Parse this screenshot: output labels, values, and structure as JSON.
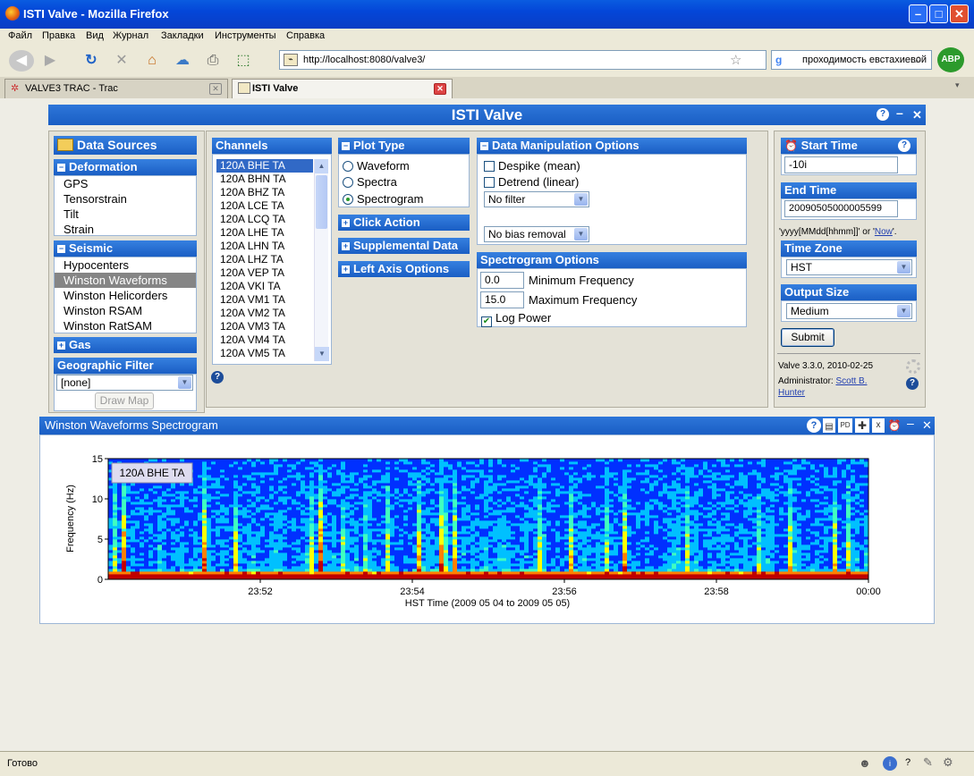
{
  "window": {
    "title": "ISTI Valve - Mozilla Firefox"
  },
  "menu": [
    "Файл",
    "Правка",
    "Вид",
    "Журнал",
    "Закладки",
    "Инструменты",
    "Справка"
  ],
  "nav": {
    "url": "http://localhost:8080/valve3/",
    "search": "проходимость евстахиевой т"
  },
  "tabs": [
    {
      "label": "VALVE3 TRAC - Trac"
    },
    {
      "label": "ISTI Valve"
    }
  ],
  "app": {
    "title": "ISTI Valve"
  },
  "sources": {
    "title": "Data Sources",
    "deformation": {
      "title": "Deformation",
      "items": [
        "GPS",
        "Tensorstrain",
        "Tilt",
        "Strain"
      ]
    },
    "seismic": {
      "title": "Seismic",
      "items": [
        "Hypocenters",
        "Winston Waveforms",
        "Winston Helicorders",
        "Winston RSAM",
        "Winston RatSAM"
      ],
      "selected": "Winston Waveforms"
    },
    "gas": {
      "title": "Gas"
    },
    "geo": {
      "title": "Geographic Filter",
      "value": "[none]",
      "draw_map": "Draw Map"
    }
  },
  "channels": {
    "title": "Channels",
    "items": [
      "120A BHE TA",
      "120A BHN TA",
      "120A BHZ TA",
      "120A LCE TA",
      "120A LCQ TA",
      "120A LHE TA",
      "120A LHN TA",
      "120A LHZ TA",
      "120A VEP TA",
      "120A VKI TA",
      "120A VM1 TA",
      "120A VM2 TA",
      "120A VM3 TA",
      "120A VM4 TA",
      "120A VM5 TA"
    ]
  },
  "plot_type": {
    "title": "Plot Type",
    "options": [
      "Waveform",
      "Spectra",
      "Spectrogram"
    ],
    "selected": "Spectrogram"
  },
  "sections": {
    "click_action": "Click Action",
    "supplemental": "Supplemental Data",
    "left_axis": "Left Axis Options"
  },
  "manip": {
    "title": "Data Manipulation Options",
    "despike": "Despike (mean)",
    "detrend": "Detrend (linear)",
    "filter": "No filter",
    "bias": "No bias removal"
  },
  "spectro": {
    "title": "Spectrogram Options",
    "min_val": "0.0",
    "min_label": "Minimum Frequency",
    "max_val": "15.0",
    "max_label": "Maximum Frequency",
    "log_power": "Log Power"
  },
  "time": {
    "start_title": "Start Time",
    "start_val": "-10i",
    "end_title": "End Time",
    "end_val": "20090505000005599",
    "hint_a": "'yyyy[MMdd[hhmm]]' or '",
    "hint_link": "Now",
    "hint_b": "'.",
    "tz_title": "Time Zone",
    "tz_val": "HST",
    "out_title": "Output Size",
    "out_val": "Medium",
    "submit": "Submit",
    "version": "Valve 3.3.0, 2010-02-25",
    "admin_label": "Administrator:",
    "admin_name": "Scott B. Hunter"
  },
  "result": {
    "title": "Winston Waveforms Spectrogram"
  },
  "chart_data": {
    "type": "heatmap",
    "channel_label": "120A BHE TA",
    "ylabel": "Frequency (Hz)",
    "xlabel": "HST Time (2009 05 04 to 2009 05 05)",
    "y_ticks": [
      "0",
      "5",
      "10",
      "15"
    ],
    "ylim": [
      0,
      15
    ],
    "x_ticks": [
      "23:52",
      "23:54",
      "23:56",
      "23:58",
      "00:00"
    ],
    "colors": [
      "#00008f",
      "#0030ff",
      "#00c0ff",
      "#40ffc0",
      "#ffff00",
      "#ff8000",
      "#c00000"
    ]
  },
  "status": {
    "text": "Готово"
  }
}
